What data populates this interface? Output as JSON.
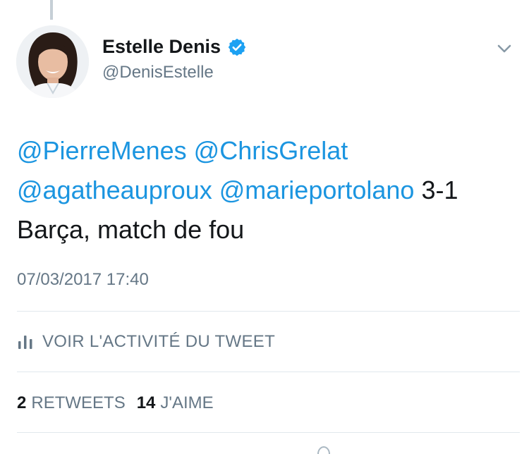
{
  "author": {
    "display_name": "Estelle Denis",
    "handle": "@DenisEstelle",
    "verified": true
  },
  "tweet": {
    "mention_1": "@PierreMenes",
    "mention_2": "@ChrisGrelat",
    "mention_3": "@agatheauproux",
    "mention_4": "@marieportolano",
    "text_1": "3-1",
    "text_2": "Barça, match de fou",
    "timestamp": "07/03/2017 17:40"
  },
  "activity": {
    "label": "VOIR L'ACTIVITÉ DU TWEET"
  },
  "stats": {
    "retweets_count": "2",
    "retweets_label": "RETWEETS",
    "likes_count": "14",
    "likes_label": "J'AIME"
  },
  "colors": {
    "link": "#1b95e0",
    "text": "#14171a",
    "secondary": "#657786",
    "verified_badge": "#1da1f2",
    "divider": "#e1e8ed"
  }
}
